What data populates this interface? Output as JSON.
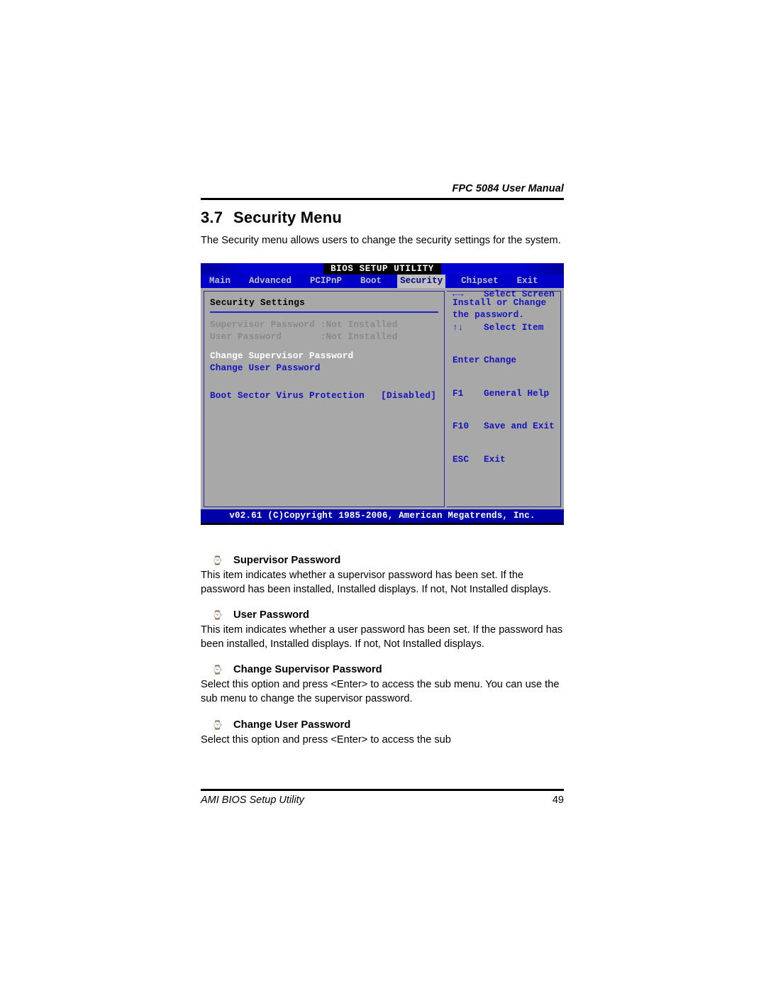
{
  "document": {
    "running_header": "FPC 5084 User Manual",
    "section_number": "3.7",
    "section_title": "Security Menu",
    "intro": "The Security menu allows users to change the security settings for the system."
  },
  "bios": {
    "title": "BIOS SETUP UTILITY",
    "menu_tabs": [
      {
        "label": "Main",
        "selected": false
      },
      {
        "label": "Advanced",
        "selected": false
      },
      {
        "label": "PCIPnP",
        "selected": false
      },
      {
        "label": "Boot",
        "selected": false
      },
      {
        "label": "Security",
        "selected": true
      },
      {
        "label": "Chipset",
        "selected": false
      },
      {
        "label": "Exit",
        "selected": false
      }
    ],
    "panel_title": "Security Settings",
    "status_rows": [
      {
        "label": "Supervisor Password",
        "value": ":Not Installed"
      },
      {
        "label": "User Password",
        "value": ":Not Installed"
      }
    ],
    "action_rows": [
      {
        "label": "Change Supervisor Password",
        "style": "white"
      },
      {
        "label": "Change User Password",
        "style": "blue"
      }
    ],
    "option_row": {
      "label": "Boot Sector Virus Protection",
      "value": "[Disabled]"
    },
    "help_text": "Install or Change the password.",
    "key_legend": [
      {
        "key": "←→",
        "action": "Select Screen"
      },
      {
        "key": "↑↓",
        "action": "Select Item"
      },
      {
        "key": "Enter",
        "action": "Change"
      },
      {
        "key": "F1",
        "action": "General Help"
      },
      {
        "key": "F10",
        "action": "Save and Exit"
      },
      {
        "key": "ESC",
        "action": "Exit"
      }
    ],
    "copyright": "v02.61 (C)Copyright 1985-2006, American Megatrends, Inc."
  },
  "items": [
    {
      "bullet": "⌚",
      "heading": "Supervisor Password",
      "text": "This item indicates whether a supervisor password has been set. If the password has been installed, Installed displays. If not, Not Installed displays."
    },
    {
      "bullet": "⌚",
      "heading": "User Password",
      "text": "This item indicates whether a user password has been set. If the password has been installed, Installed displays. If not, Not Installed displays."
    },
    {
      "bullet": "⌚",
      "heading": "Change Supervisor Password",
      "text": "Select this option and press <Enter> to access the sub menu. You can use the sub menu to change the supervisor password."
    },
    {
      "bullet": "⌚",
      "heading": "Change User Password",
      "text": "Select this option and press <Enter> to access the sub"
    }
  ],
  "footer": {
    "left": "AMI BIOS Setup Utility",
    "page_number": "49"
  },
  "colors": {
    "bios_blue": "#0000c8",
    "bios_panel_gray": "#a8a8a8",
    "bios_text_blue": "#1515bb",
    "bios_dim": "#8a8a8a"
  }
}
